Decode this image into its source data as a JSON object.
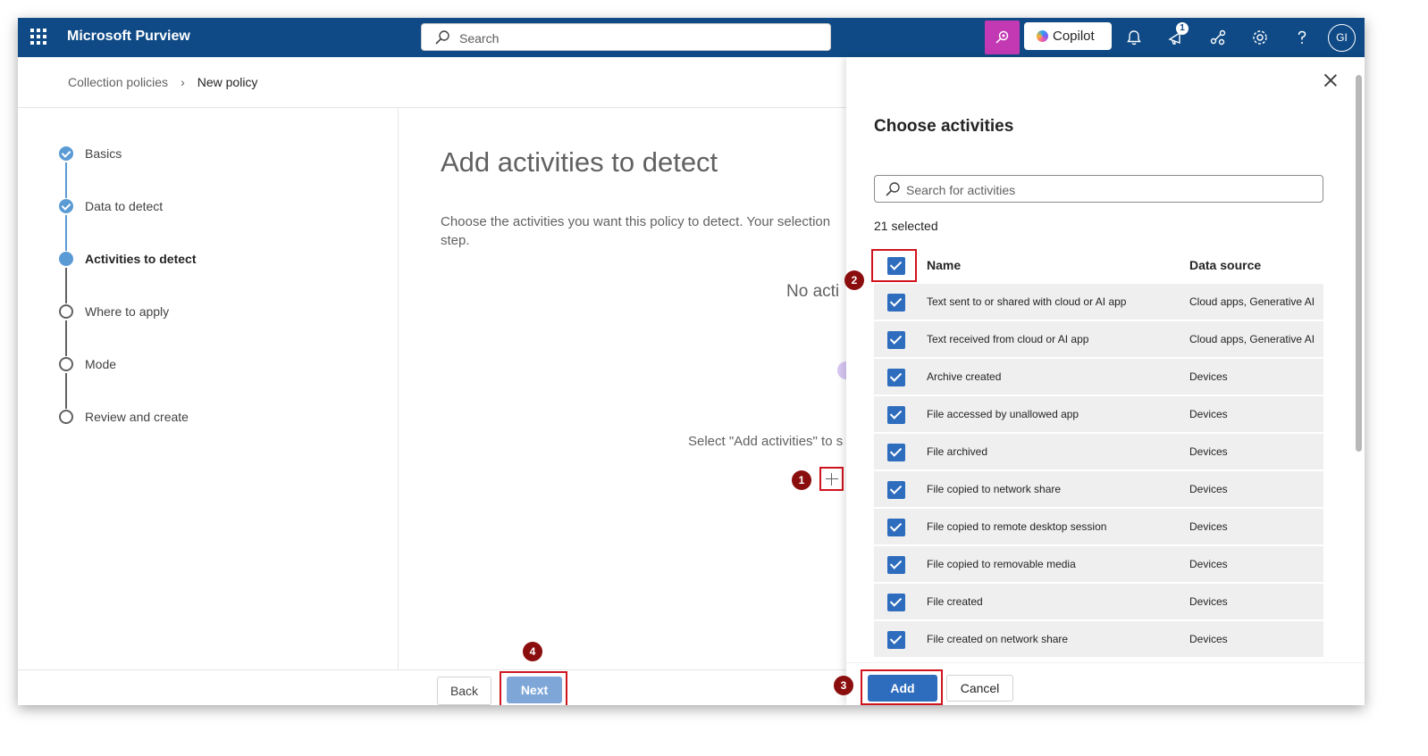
{
  "topbar": {
    "app_title": "Microsoft Purview",
    "search_placeholder": "Search",
    "copilot_label": "Copilot",
    "notification_badge": "1",
    "avatar_initials": "GI"
  },
  "breadcrumb": {
    "parent": "Collection policies",
    "current": "New policy"
  },
  "steps": [
    {
      "label": "Basics",
      "status": "done"
    },
    {
      "label": "Data to detect",
      "status": "done"
    },
    {
      "label": "Activities to detect",
      "status": "current"
    },
    {
      "label": "Where to apply",
      "status": "todo"
    },
    {
      "label": "Mode",
      "status": "todo"
    },
    {
      "label": "Review and create",
      "status": "todo"
    }
  ],
  "main": {
    "title": "Add activities to detect",
    "description": "Choose the activities you want this policy to detect. Your selection step.",
    "empty_title": "No acti",
    "hint": "Select \"Add activities\" to s"
  },
  "footer": {
    "back_label": "Back",
    "next_label": "Next"
  },
  "callouts": {
    "one": "1",
    "two": "2",
    "three": "3",
    "four": "4"
  },
  "panel": {
    "title": "Choose activities",
    "search_placeholder": "Search for activities",
    "selected_count": "21 selected",
    "col_name": "Name",
    "col_source": "Data source",
    "rows": [
      {
        "name": "Text sent to or shared with cloud or AI app",
        "source": "Cloud apps, Generative AI"
      },
      {
        "name": "Text received from cloud or AI app",
        "source": "Cloud apps, Generative AI"
      },
      {
        "name": "Archive created",
        "source": "Devices"
      },
      {
        "name": "File accessed by unallowed app",
        "source": "Devices"
      },
      {
        "name": "File archived",
        "source": "Devices"
      },
      {
        "name": "File copied to network share",
        "source": "Devices"
      },
      {
        "name": "File copied to remote desktop session",
        "source": "Devices"
      },
      {
        "name": "File copied to removable media",
        "source": "Devices"
      },
      {
        "name": "File created",
        "source": "Devices"
      },
      {
        "name": "File created on network share",
        "source": "Devices"
      }
    ],
    "add_label": "Add",
    "cancel_label": "Cancel"
  },
  "colors": {
    "topbar": "#0f4a86",
    "accent": "#2e6cbd",
    "highlight": "#d0141e",
    "callout": "#8b0e0e",
    "copilot_button": "#c239b3"
  }
}
